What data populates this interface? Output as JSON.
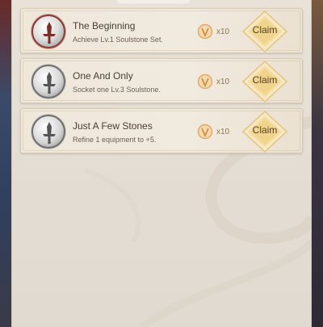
{
  "quests": [
    {
      "title": "The Beginning",
      "description": "Achieve Lv.1 Soulstone Set.",
      "reward_count": "x10",
      "claim_label": "Claim",
      "medal_color": "#8a3a32"
    },
    {
      "title": "One And Only",
      "description": "Socket one Lv.3 Soulstone.",
      "reward_count": "x10",
      "claim_label": "Claim",
      "medal_color": "#6e6e6e"
    },
    {
      "title": "Just A Few Stones",
      "description": "Refine 1 equipment to +5.",
      "reward_count": "x10",
      "claim_label": "Claim",
      "medal_color": "#6e6e6e"
    }
  ],
  "colors": {
    "panel": "#e6e0d6",
    "card": "#efe7da",
    "claim_gold": "#e8c77a",
    "title_text": "#4a3e33"
  },
  "icons": {
    "medal": "sword-medal-icon",
    "reward": "soulstone-currency-icon",
    "claim": "diamond-claim-icon"
  }
}
